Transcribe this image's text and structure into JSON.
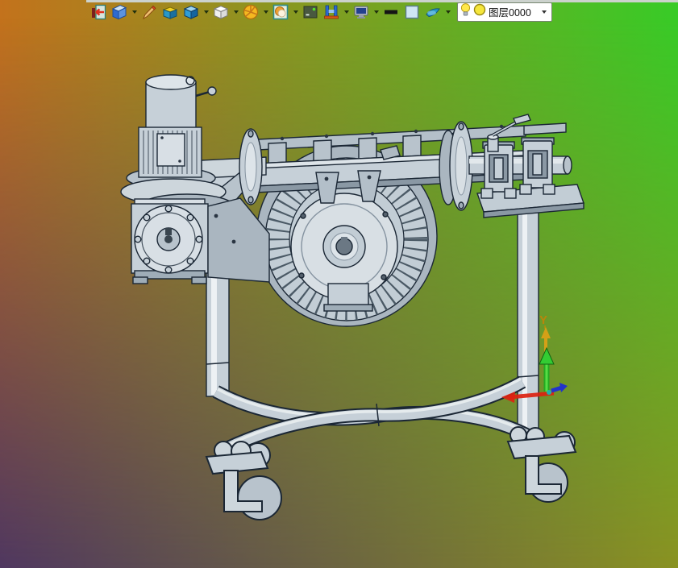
{
  "background": {
    "top_left": "#c3721c",
    "top_right": "#38cb27",
    "bottom_left": "#4f3760",
    "bottom_right": "#8a9222"
  },
  "toolbar": {
    "icons": [
      {
        "name": "exit-render-icon",
        "dropdown": false
      },
      {
        "name": "notebook-icon",
        "dropdown": true
      },
      {
        "name": "pen-icon",
        "dropdown": false
      },
      {
        "name": "material-box-icon",
        "dropdown": false
      },
      {
        "name": "shaded-cube-icon",
        "dropdown": true
      },
      {
        "name": "wireframe-cube-icon",
        "dropdown": true
      },
      {
        "name": "pie-wheel-icon",
        "dropdown": true
      },
      {
        "name": "image-zoom-icon",
        "dropdown": true
      },
      {
        "name": "render-scene-icon",
        "dropdown": false
      },
      {
        "name": "floor-grid-icon",
        "dropdown": true
      },
      {
        "name": "monitor-icon",
        "dropdown": true
      },
      {
        "name": "line-width-icon",
        "dropdown": false
      },
      {
        "name": "color-swatch-icon",
        "dropdown": false
      },
      {
        "name": "surface-icon",
        "dropdown": true
      }
    ],
    "layer_combo": {
      "value": "图层0000",
      "icons": [
        "bulb-icon",
        "layer-color-icon"
      ]
    }
  },
  "viewport": {
    "axes_triad": {
      "y_label": "Y",
      "y_axis_color": "#2db52b",
      "x_axis_color": "#dd2211",
      "z_axis_color": "#2233cc",
      "label_color": "#b8860b"
    },
    "model_part_color": "#c6d0d8",
    "model_outline_color": "#1b2735"
  }
}
